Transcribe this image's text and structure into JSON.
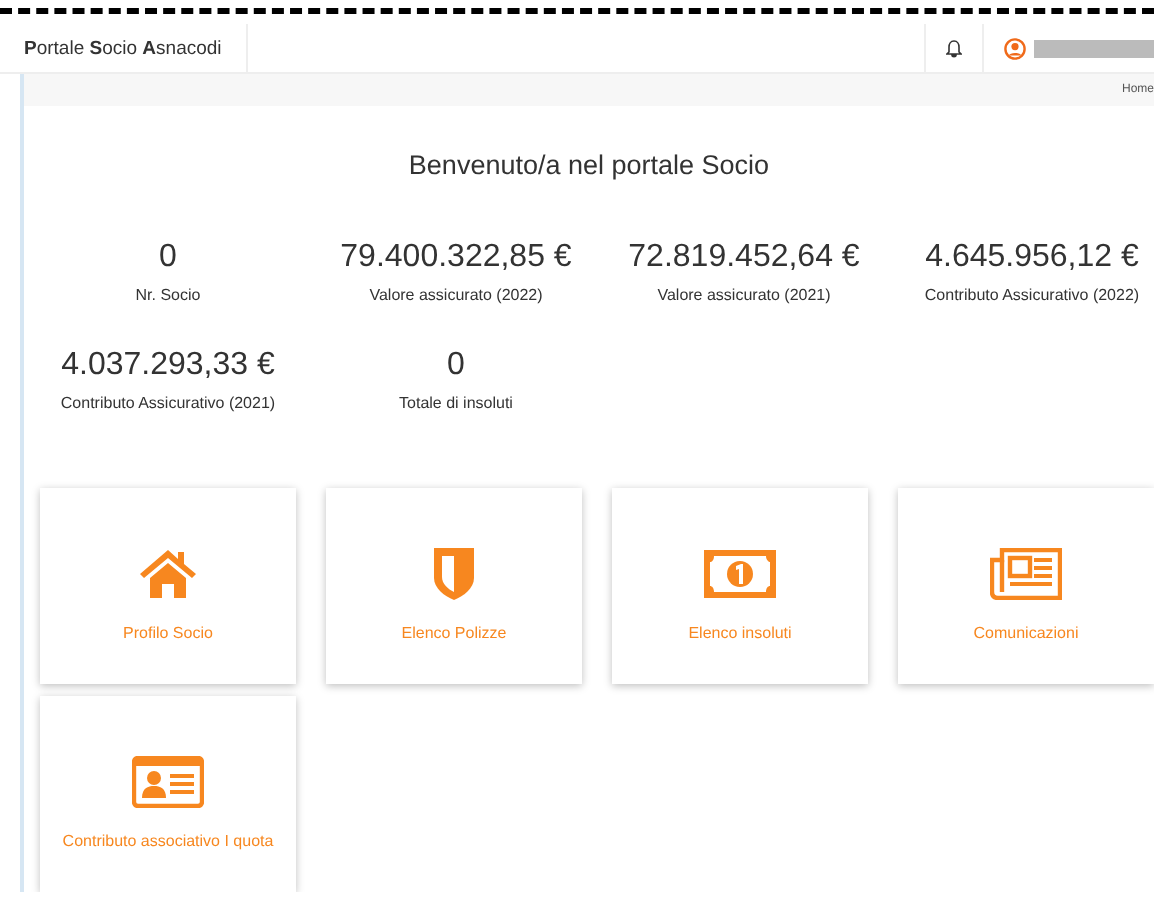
{
  "header": {
    "brand": "**P**ortale **S**ocio **A**snacodi",
    "breadcrumb": "Home"
  },
  "welcome": "Benvenuto/a nel portale Socio",
  "stats": [
    {
      "value": "0",
      "label": "Nr. Socio"
    },
    {
      "value": "79.400.322,85 €",
      "label": "Valore assicurato (2022)"
    },
    {
      "value": "72.819.452,64 €",
      "label": "Valore assicurato (2021)"
    },
    {
      "value": "4.645.956,12 €",
      "label": "Contributo Assicurativo (2022)"
    },
    {
      "value": "4.037.293,33 €",
      "label": "Contributo Assicurativo (2021)"
    },
    {
      "value": "0",
      "label": "Totale di insoluti"
    }
  ],
  "cards": [
    {
      "kind": "home",
      "label": "Profilo Socio"
    },
    {
      "kind": "shield",
      "label": "Elenco Polizze"
    },
    {
      "kind": "money",
      "label": "Elenco insoluti"
    },
    {
      "kind": "news",
      "label": "Comunicazioni"
    },
    {
      "kind": "idcard",
      "label": "Contributo associativo I quota"
    }
  ]
}
